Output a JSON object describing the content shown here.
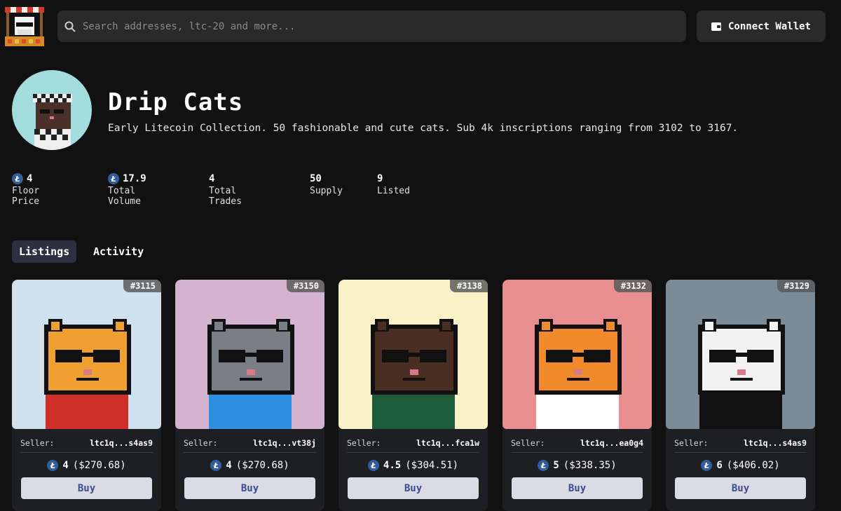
{
  "header": {
    "search_placeholder": "Search addresses, ltc-20 and more...",
    "connect_label": "Connect Wallet"
  },
  "collection": {
    "title": "Drip Cats",
    "description": "Early Litecoin Collection. 50 fashionable and cute cats. Sub 4k inscriptions ranging from 3102 to 3167."
  },
  "stats": [
    {
      "value": "4",
      "label": "Floor Price",
      "ltc": true
    },
    {
      "value": "17.9",
      "label": "Total Volume",
      "ltc": true
    },
    {
      "value": "4",
      "label": "Total Trades",
      "ltc": false
    },
    {
      "value": "50",
      "label": "Supply",
      "ltc": false
    },
    {
      "value": "9",
      "label": "Listed",
      "ltc": false
    }
  ],
  "tabs": [
    {
      "label": "Listings",
      "active": true
    },
    {
      "label": "Activity",
      "active": false
    }
  ],
  "listing_labels": {
    "seller": "Seller:",
    "buy": "Buy",
    "currency_glyph": "Ł"
  },
  "listings": [
    {
      "id": "#3115",
      "seller": "ltc1q...s4as9",
      "amount": "4",
      "usd": "($270.68)",
      "bg": "#cfe0ee",
      "fur": "#f0a030",
      "accent": "#d0302a"
    },
    {
      "id": "#3150",
      "seller": "ltc1q...vt38j",
      "amount": "4",
      "usd": "($270.68)",
      "bg": "#d4b3d1",
      "fur": "#7a7f86",
      "accent": "#2d8fe0"
    },
    {
      "id": "#3138",
      "seller": "ltc1q...fca1w",
      "amount": "4.5",
      "usd": "($304.51)",
      "bg": "#fbf3c8",
      "fur": "#4a2e22",
      "accent": "#1c5c3a"
    },
    {
      "id": "#3132",
      "seller": "ltc1q...ea0g4",
      "amount": "5",
      "usd": "($338.35)",
      "bg": "#e98f8f",
      "fur": "#f08a2a",
      "accent": "#ffffff"
    },
    {
      "id": "#3129",
      "seller": "ltc1q...s4as9",
      "amount": "6",
      "usd": "($406.02)",
      "bg": "#7b8c98",
      "fur": "#f2f2f2",
      "accent": "#111111"
    }
  ],
  "colors": {
    "background": "#111111",
    "surface": "#2a2a2a",
    "card": "#1d1f23",
    "ltc_blue": "#345d9d",
    "buy_bg": "#d9dbe5",
    "buy_text": "#3d4a8e"
  }
}
